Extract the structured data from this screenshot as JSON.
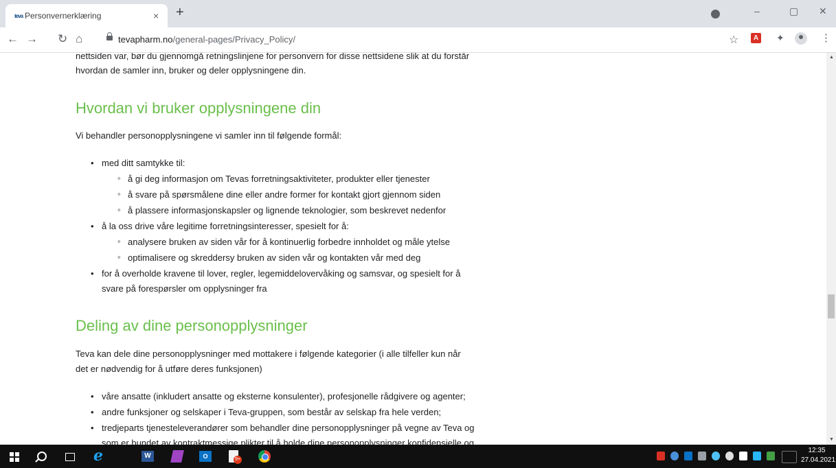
{
  "browser": {
    "tab": {
      "title": "Personvernerklæring",
      "favicon": "teva-favicon",
      "close": "×"
    },
    "new_tab": "+",
    "window": {
      "minimize": "–",
      "maximize": "▢",
      "close": "✕"
    },
    "toolbar": {
      "back": "←",
      "forward": "→",
      "reload": "↻",
      "home": "⌂",
      "star": "☆",
      "menu": "⋮",
      "puzzle": "✦",
      "pdf_ext": "A"
    },
    "url": {
      "host": "tevapharm.no",
      "path": "/general-pages/Privacy_Policy/"
    }
  },
  "page": {
    "intro_lines": [
      "nettsiden var, bør du gjennomgå retningslinjene for personvern for disse nettsidene slik at du forstår",
      "hvordan de samler inn, bruker og deler opplysningene din."
    ],
    "section1": {
      "heading": "Hvordan vi bruker opplysningene din",
      "lead": "Vi behandler personopplysningene vi samler inn til følgende formål:",
      "items": [
        {
          "level": 1,
          "text": "med ditt samtykke til:"
        },
        {
          "level": 2,
          "text": "å gi deg informasjon om Tevas forretningsaktiviteter, produkter eller tjenester"
        },
        {
          "level": 2,
          "text": "å svare på spørsmålene dine eller andre former for kontakt gjort gjennom siden"
        },
        {
          "level": 2,
          "text": "å plassere informasjonskapsler og lignende teknologier, som beskrevet nedenfor"
        },
        {
          "level": 1,
          "text": "å la oss drive våre legitime forretningsinteresser, spesielt for å:"
        },
        {
          "level": 2,
          "text": "analysere bruken av siden vår for å kontinuerlig forbedre innholdet og måle ytelse"
        },
        {
          "level": 2,
          "text": "optimalisere og skreddersy bruken av siden vår og kontakten vår med deg"
        },
        {
          "level": 1,
          "text": "for å overholde kravene til lover, regler, legemiddelovervåking og samsvar, og spesielt for å"
        },
        {
          "level": 1,
          "text": "svare på forespørsler om opplysninger fra",
          "continuation": true
        }
      ]
    },
    "section2": {
      "heading": "Deling av dine personopplysninger",
      "lead_lines": [
        "Teva kan dele dine personopplysninger med mottakere i følgende kategorier (i alle tilfeller kun når",
        "det er nødvendig for å utføre deres funksjonen)"
      ],
      "items": [
        {
          "text": "våre ansatte (inkludert ansatte og eksterne konsulenter), profesjonelle rådgivere og agenter;"
        },
        {
          "text": "andre funksjoner og selskaper i Teva-gruppen, som består av selskap fra hele verden;"
        },
        {
          "text": "tredjeparts tjenesteleverandører som behandler dine personopplysninger på vegne av Teva og"
        },
        {
          "text": "som er bundet av kontraktmessige plikter til å holde dine personopplysninger konfidensielle og",
          "continuation": true
        }
      ]
    },
    "colors": {
      "heading": "#6abf4b",
      "text": "#202124"
    }
  },
  "taskbar": {
    "apps": [
      "windows-start-icon",
      "search-icon",
      "task-view-icon",
      "internet-explorer-icon",
      "word-icon",
      "onenote-icon",
      "outlook-icon",
      "acrobat-icon",
      "chrome-icon"
    ],
    "word_label": "W",
    "outlook_label": "O",
    "ie_label": "e",
    "clock": {
      "time": "12:35",
      "date": "27.04.2021"
    }
  }
}
